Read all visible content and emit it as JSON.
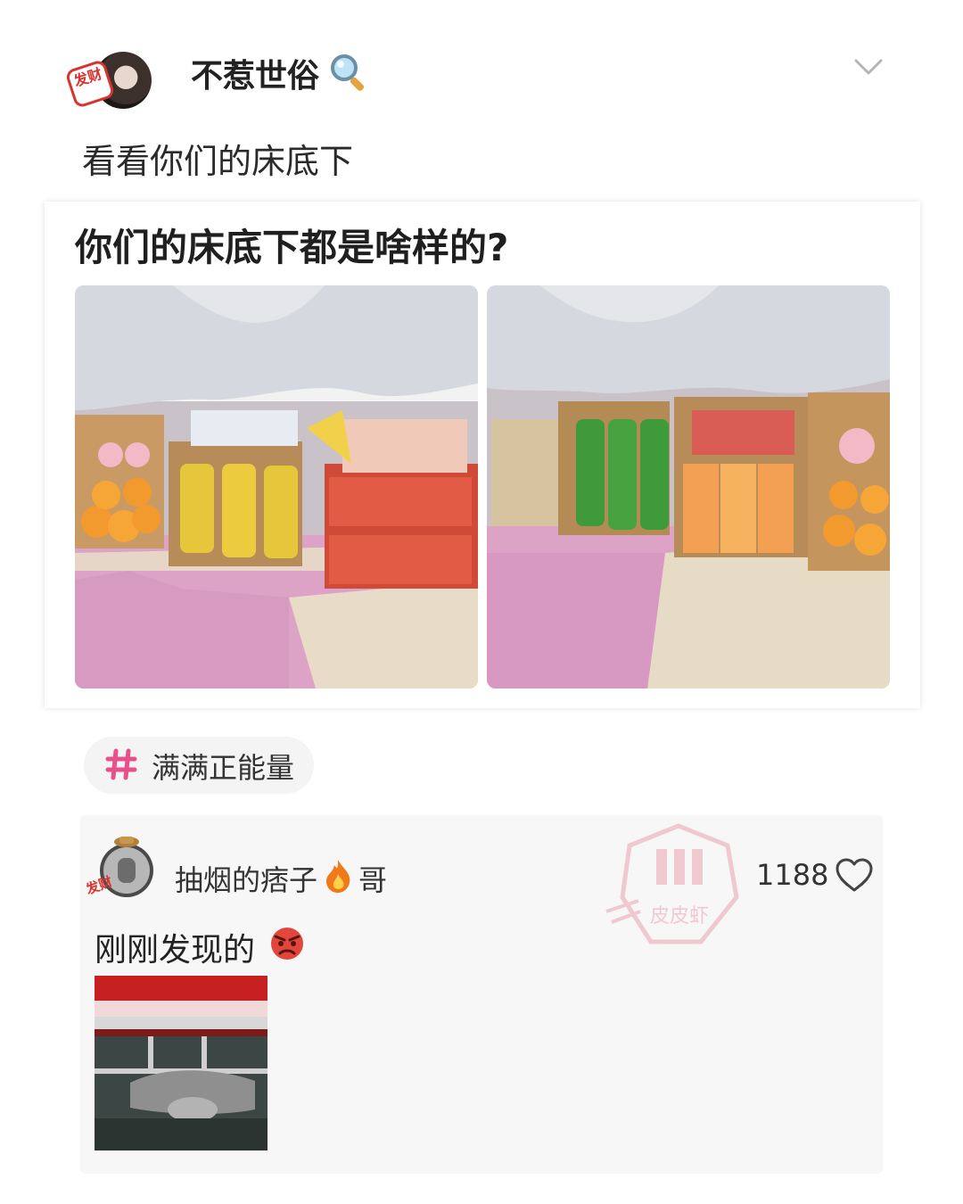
{
  "post": {
    "author": {
      "name": "不惹世俗",
      "avatar_badge": "发财"
    },
    "text": "看看你们的床底下",
    "embedded_card": {
      "title": "你们的床底下都是啥样的?"
    },
    "hashtag": "满满正能量"
  },
  "comment": {
    "author_name": "抽烟的痞子",
    "author_name_suffix": "哥",
    "avatar_badge": "发财",
    "like_count": "1188",
    "text": "刚刚发现的",
    "watermark_text": "皮皮虾"
  },
  "icons": {
    "header_emoji": "magnifier-icon",
    "more": "chevron-down-icon",
    "hashtag": "hash-icon",
    "name_emoji": "fire-icon",
    "like": "heart-like-icon",
    "comment_emoji": "angry-face-icon"
  },
  "colors": {
    "hashtag_accent": "#e8508a",
    "badge_red": "#d8342e",
    "floor_pink": "#dca3c6",
    "watermark_pink": "#e9a2b2"
  }
}
